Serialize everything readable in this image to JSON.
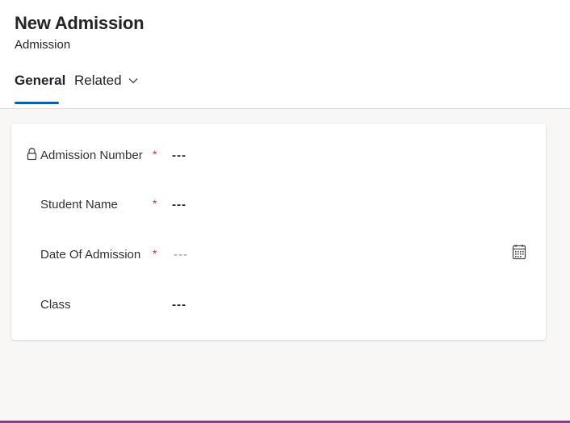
{
  "header": {
    "title": "New Admission",
    "subtitle": "Admission"
  },
  "tabs": [
    {
      "label": "General",
      "selected": true
    },
    {
      "label": "Related",
      "selected": false,
      "icon": "chevron-down-icon"
    }
  ],
  "form": {
    "required_marker": "*",
    "fields": [
      {
        "label": "Admission Number",
        "value": "---",
        "required": true,
        "locked": true
      },
      {
        "label": "Student Name",
        "value": "---",
        "required": true,
        "locked": false
      },
      {
        "label": "Date Of Admission",
        "placeholder": "---",
        "required": true,
        "icon": "calendar-icon"
      },
      {
        "label": "Class",
        "value": "---",
        "required": false
      }
    ]
  },
  "colors": {
    "accent": "#115ea3",
    "required": "#c4314b",
    "bottom_border": "#8a3a9e"
  }
}
